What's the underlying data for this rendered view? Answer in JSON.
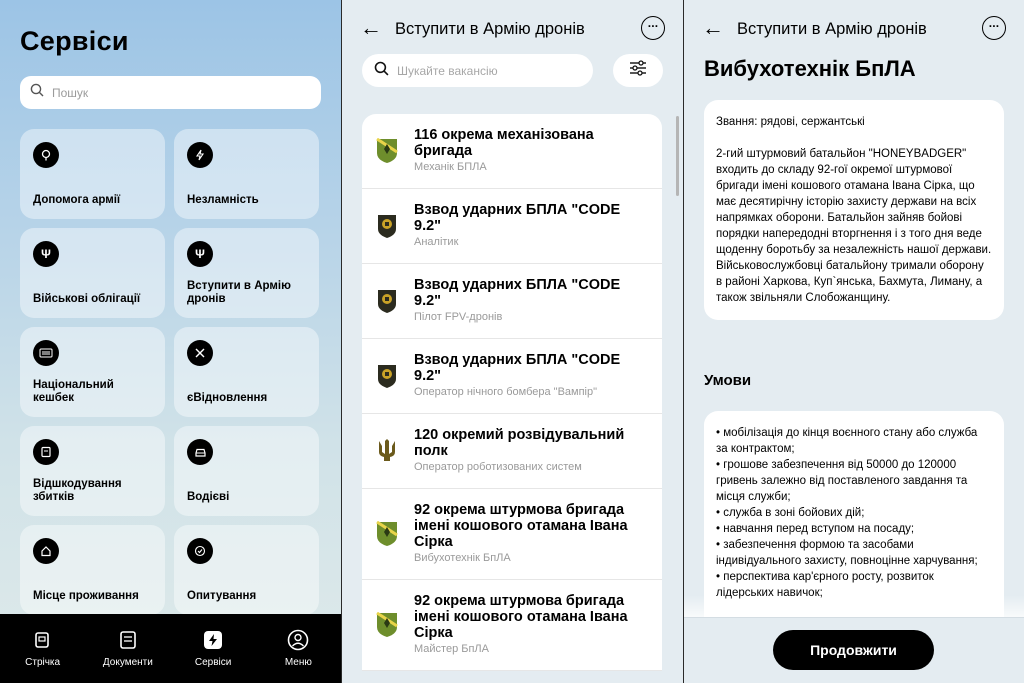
{
  "services": {
    "title": "Сервіси",
    "search_placeholder": "Пошук",
    "tiles": [
      {
        "label": "Допомога армії",
        "icon": "heart-hand-icon"
      },
      {
        "label": "Незламність",
        "icon": "lightning-icon"
      },
      {
        "label": "Військові облігації",
        "icon": "trident-icon"
      },
      {
        "label": "Вступити в Армію дронів",
        "icon": "trident-icon"
      },
      {
        "label": "Національний кешбек",
        "icon": "barcode-icon"
      },
      {
        "label": "єВідновлення",
        "icon": "tools-icon"
      },
      {
        "label": "Відшкодування збитків",
        "icon": "document-icon"
      },
      {
        "label": "Водієві",
        "icon": "car-icon"
      },
      {
        "label": "Місце проживання",
        "icon": "home-icon"
      },
      {
        "label": "Опитування",
        "icon": "check-circle-icon"
      }
    ],
    "tabbar": [
      {
        "label": "Стрічка",
        "icon": "feed-icon"
      },
      {
        "label": "Документи",
        "icon": "documents-icon"
      },
      {
        "label": "Сервіси",
        "icon": "services-icon"
      },
      {
        "label": "Меню",
        "icon": "user-icon"
      }
    ]
  },
  "vacancies": {
    "header_title": "Вступити в Армію дронів",
    "search_placeholder": "Шукайте вакансію",
    "jobs": [
      {
        "title": "116 окрема механізована бригада",
        "subtitle": "Механік БПЛА",
        "emblem": "green-shield"
      },
      {
        "title": "Взвод ударних БПЛА \"CODE 9.2\"",
        "subtitle": "Аналітик",
        "emblem": "dark-shield"
      },
      {
        "title": "Взвод ударних БПЛА \"CODE 9.2\"",
        "subtitle": "Пілот FPV-дронів",
        "emblem": "dark-shield"
      },
      {
        "title": "Взвод ударних БПЛА \"CODE 9.2\"",
        "subtitle": "Оператор нічного бомбера \"Вампір\"",
        "emblem": "dark-shield"
      },
      {
        "title": "120 окремий розвідувальний полк",
        "subtitle": "Оператор роботизованих систем",
        "emblem": "trident"
      },
      {
        "title": "92 окрема штурмова бригада імені кошового отамана Івана Сірка",
        "subtitle": "Вибухотехнік БпЛА",
        "emblem": "green-shield"
      },
      {
        "title": "92 окрема штурмова бригада імені кошового отамана Івана Сірка",
        "subtitle": "Майстер БпЛА",
        "emblem": "green-shield"
      }
    ]
  },
  "detail": {
    "header_title": "Вступити в Армію дронів",
    "title": "Вибухотехнік БпЛА",
    "rank": "Звання: рядові, сержантські",
    "description": "2-гий штурмовий батальйон \"HONEYBADGER\" входить до складу 92-гої окремої штурмової бригади імені кошового отамана Івана Сірка, що має десятирічну історію захисту держави на всіх напрямках оборони. Батальйон зайняв бойові порядки напередодні вторгнення і з того дня веде щоденну боротьбу за незалежність нашої держави. Військовослужбовці батальйону тримали оборону в районі Харкова, Куп`янська, Бахмута, Лиману, а також звільняли Слобожанщину.",
    "conditions_title": "Умови",
    "conditions": [
      "• мобілізація до кінця воєнного стану або служба за контрактом;",
      "• грошове забезпечення від 50000 до 120000 гривень залежно від поставленого завдання та місця служби;",
      "• служба в зоні бойових дій;",
      "• навчання перед вступом на посаду;",
      "• забезпечення формою та засобами індивідуального захисту, повноцінне харчування;",
      "• перспектива кар'єрного росту, розвиток лідерських навичок;"
    ],
    "continue_label": "Продовжити"
  }
}
